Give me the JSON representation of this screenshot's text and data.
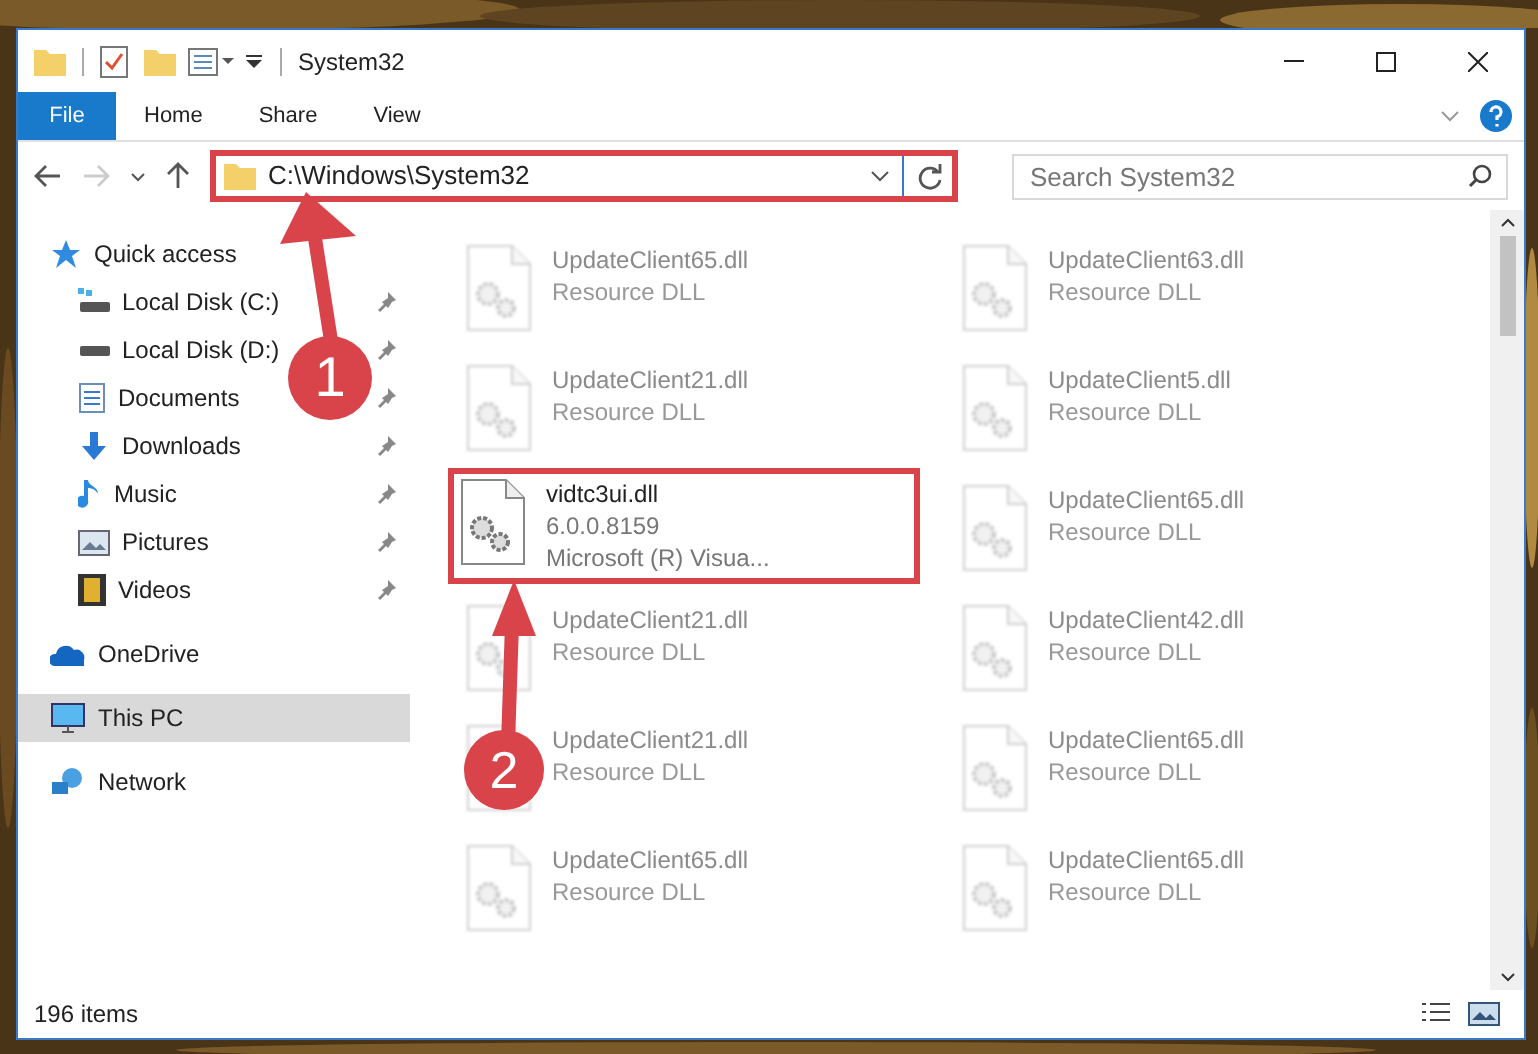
{
  "window": {
    "title": "System32"
  },
  "ribbon_tabs": [
    {
      "label": "File",
      "kind": "menu"
    },
    {
      "label": "Home",
      "kind": "tab"
    },
    {
      "label": "Share",
      "kind": "tab"
    },
    {
      "label": "View",
      "kind": "tab"
    }
  ],
  "address_bar": {
    "path": "C:\\Windows\\System32",
    "highlighted": true
  },
  "search": {
    "placeholder": "Search System32"
  },
  "sidebar": {
    "items": [
      {
        "label": "Quick access",
        "selected": false,
        "children": [
          {
            "label": "Local Disk (C:)",
            "pinned": true
          },
          {
            "label": "Local Disk (D:)",
            "pinned": true
          },
          {
            "label": "Documents",
            "pinned": true
          },
          {
            "label": "Downloads",
            "pinned": true
          },
          {
            "label": "Music",
            "pinned": true
          },
          {
            "label": "Pictures",
            "pinned": true
          },
          {
            "label": "Videos",
            "pinned": true
          }
        ]
      },
      {
        "label": "OneDrive",
        "selected": false
      },
      {
        "label": "This PC",
        "selected": true
      },
      {
        "label": "Network",
        "selected": false
      }
    ]
  },
  "files": [
    {
      "name": "UpdateClient65.dll",
      "lines": [
        "Resource DLL"
      ],
      "blurred": true,
      "highlighted": false
    },
    {
      "name": "UpdateClient63.dll",
      "lines": [
        "Resource DLL"
      ],
      "blurred": true,
      "highlighted": false
    },
    {
      "name": "UpdateClient21.dll",
      "lines": [
        "Resource DLL"
      ],
      "blurred": true,
      "highlighted": false
    },
    {
      "name": "UpdateClient5.dll",
      "lines": [
        "Resource DLL"
      ],
      "blurred": true,
      "highlighted": false
    },
    {
      "name": "vidtc3ui.dll",
      "lines": [
        "6.0.0.8159",
        "Microsoft (R) Visua..."
      ],
      "blurred": false,
      "highlighted": true
    },
    {
      "name": "UpdateClient65.dll",
      "lines": [
        "Resource DLL"
      ],
      "blurred": true,
      "highlighted": false
    },
    {
      "name": "UpdateClient21.dll",
      "lines": [
        "Resource DLL"
      ],
      "blurred": true,
      "highlighted": false
    },
    {
      "name": "UpdateClient42.dll",
      "lines": [
        "Resource DLL"
      ],
      "blurred": true,
      "highlighted": false
    },
    {
      "name": "UpdateClient21.dll",
      "lines": [
        "Resource DLL"
      ],
      "blurred": true,
      "highlighted": false
    },
    {
      "name": "UpdateClient65.dll",
      "lines": [
        "Resource DLL"
      ],
      "blurred": true,
      "highlighted": false
    },
    {
      "name": "UpdateClient65.dll",
      "lines": [
        "Resource DLL"
      ],
      "blurred": true,
      "highlighted": false
    },
    {
      "name": "UpdateClient65.dll",
      "lines": [
        "Resource DLL"
      ],
      "blurred": true,
      "highlighted": false
    }
  ],
  "status_bar": {
    "count": "196 items"
  },
  "annotations": [
    {
      "label": "1"
    },
    {
      "label": "2"
    }
  ]
}
